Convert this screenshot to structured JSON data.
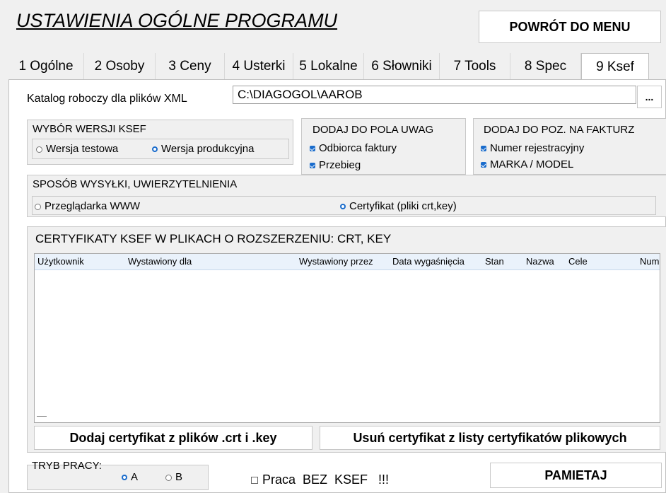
{
  "header": {
    "title": "USTAWIENIA OGÓLNE  PROGRAMU",
    "back_button": "POWRÓT DO MENU"
  },
  "tabs": [
    {
      "label": "1 Ogólne"
    },
    {
      "label": "2 Osoby"
    },
    {
      "label": "3 Ceny"
    },
    {
      "label": "4 Usterki"
    },
    {
      "label": "5 Lokalne"
    },
    {
      "label": "6 Słowniki"
    },
    {
      "label": "7 Tools"
    },
    {
      "label": "8 Spec"
    },
    {
      "label": "9 Ksef"
    }
  ],
  "xml_dir": {
    "label": "Katalog roboczy dla plików XML",
    "value": "C:\\DIAGOGOL\\AAROB",
    "browse": "..."
  },
  "version": {
    "title": "WYBÓR WERSJI KSEF",
    "test": "Wersja testowa",
    "prod": "Wersja produkcyjna",
    "selected": "prod"
  },
  "remarks": {
    "title": "DODAJ DO POLA UWAG",
    "options": [
      "Odbiorca faktury",
      "Przebieg"
    ]
  },
  "invoice": {
    "title": "DODAJ DO POZ. NA FAKTURZ",
    "options": [
      "Numer rejestracyjny",
      "MARKA / MODEL"
    ]
  },
  "auth": {
    "title": "SPOSÓB WYSYŁKI, UWIERZYTELNIENIA",
    "browser": "Przeglądarka WWW",
    "cert": "Certyfikat (pliki crt,key)",
    "selected": "cert"
  },
  "certs": {
    "title": "CERTYFIKATY KSEF W PLIKACH O ROZSZERZENIU: CRT, KEY",
    "columns": [
      "Użytkownik",
      "Wystawiony dla",
      "Wystawiony przez",
      "Data wygaśnięcia",
      "Stan",
      "Nazwa",
      "Cele",
      "Num"
    ],
    "rows": [],
    "add_button": "Dodaj certyfikat z plików .crt i .key",
    "remove_button": "Usuń certyfikat z listy certyfikatów plikowych"
  },
  "mode": {
    "label": "TRYB PRACY:",
    "a": "A",
    "b": "B",
    "selected": "A"
  },
  "no_ksef": {
    "label": "Praca  BEZ  KSEF   !!!",
    "checked": false
  },
  "save_button": "PAMIETAJ",
  "accent": "#1a6ccc"
}
